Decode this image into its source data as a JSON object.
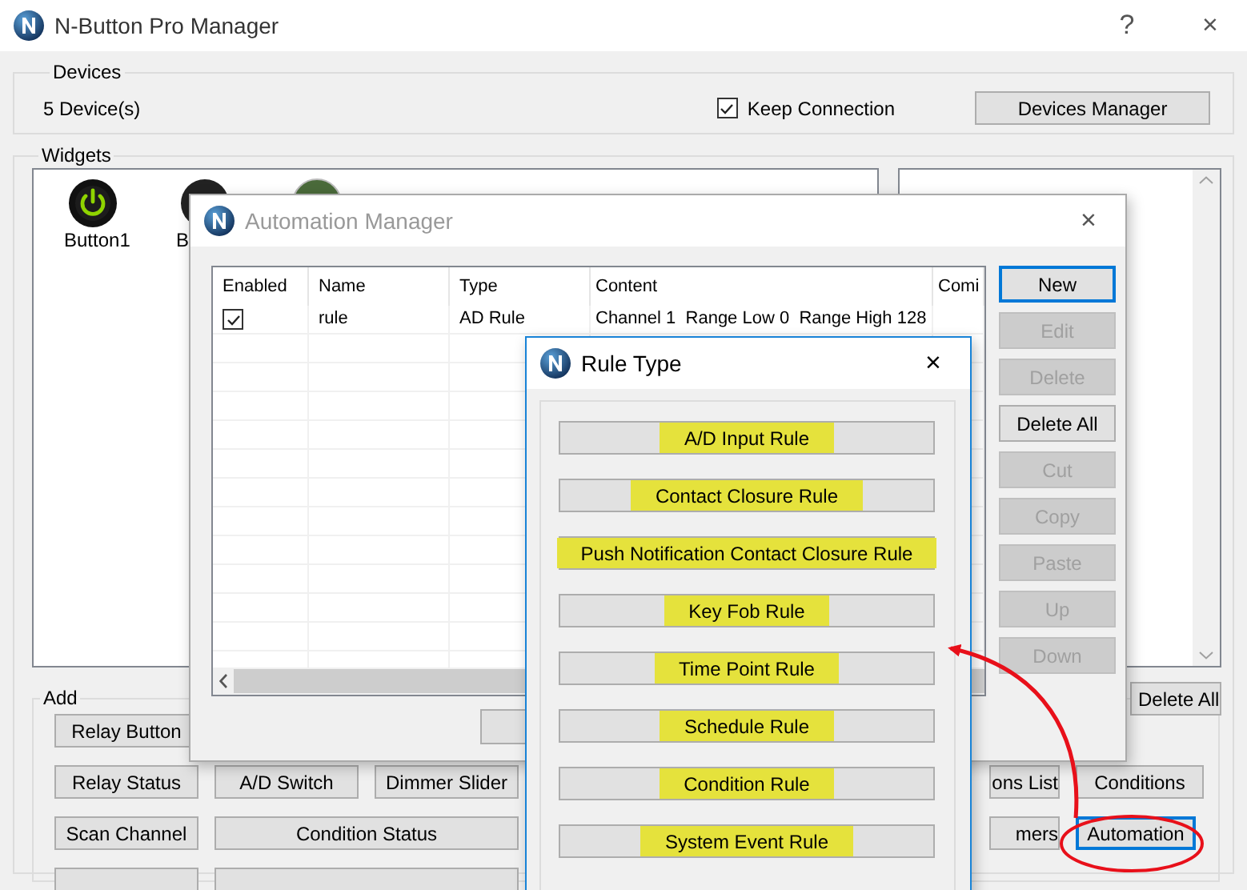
{
  "main_window": {
    "title": "N-Button Pro Manager",
    "help": "?",
    "close": "×"
  },
  "devices": {
    "label": "Devices",
    "count": "5 Device(s)",
    "keep_connection": {
      "label": "Keep Connection",
      "checked": true
    },
    "manager_button": "Devices Manager"
  },
  "widgets": {
    "label": "Widgets",
    "items": [
      {
        "label": "Button1",
        "kind": "power"
      },
      {
        "label": "B",
        "kind": "dark"
      },
      {
        "kind": "green"
      }
    ],
    "delete_all": "Delete All"
  },
  "add": {
    "label": "Add",
    "buttons": [
      {
        "label": "Relay Button",
        "selected": false
      },
      {
        "label": "Relay Status",
        "selected": false
      },
      {
        "label": "A/D Switch",
        "selected": false
      },
      {
        "label": "Dimmer Slider",
        "selected": false
      },
      {
        "label": "ons List",
        "selected": false
      },
      {
        "label": "Conditions",
        "selected": false
      },
      {
        "label": "Scan Channel",
        "selected": false
      },
      {
        "label": "Condition Status",
        "selected": false
      },
      {
        "label": "mers",
        "selected": false
      },
      {
        "label": "Automation",
        "selected": true
      }
    ]
  },
  "automation_manager": {
    "title": "Automation Manager",
    "close": "×",
    "columns": [
      "Enabled",
      "Name",
      "Type",
      "Content",
      "Comi"
    ],
    "rows": [
      {
        "enabled": true,
        "name": "rule",
        "type": "AD Rule",
        "content": "Channel 1  Range Low 0  Range High 128"
      }
    ],
    "buttons": [
      {
        "label": "New",
        "disabled": false,
        "selected": true
      },
      {
        "label": "Edit",
        "disabled": true,
        "selected": false
      },
      {
        "label": "Delete",
        "disabled": true,
        "selected": false
      },
      {
        "label": "Delete All",
        "disabled": false,
        "selected": false
      },
      {
        "label": "Cut",
        "disabled": true,
        "selected": false
      },
      {
        "label": "Copy",
        "disabled": true,
        "selected": false
      },
      {
        "label": "Paste",
        "disabled": true,
        "selected": false
      },
      {
        "label": "Up",
        "disabled": true,
        "selected": false
      },
      {
        "label": "Down",
        "disabled": true,
        "selected": false
      }
    ]
  },
  "rule_type": {
    "title": "Rule Type",
    "close": "×",
    "buttons": [
      {
        "label": "A/D Input Rule",
        "highlighted": true
      },
      {
        "label": "Contact Closure Rule",
        "highlighted": true
      },
      {
        "label": "Push Notification Contact Closure Rule",
        "highlighted": true
      },
      {
        "label": "Key Fob Rule",
        "highlighted": true
      },
      {
        "label": "Time Point Rule",
        "highlighted": true
      },
      {
        "label": "Schedule Rule",
        "highlighted": true
      },
      {
        "label": "Condition Rule",
        "highlighted": true
      },
      {
        "label": "System Event Rule",
        "highlighted": true
      }
    ]
  }
}
